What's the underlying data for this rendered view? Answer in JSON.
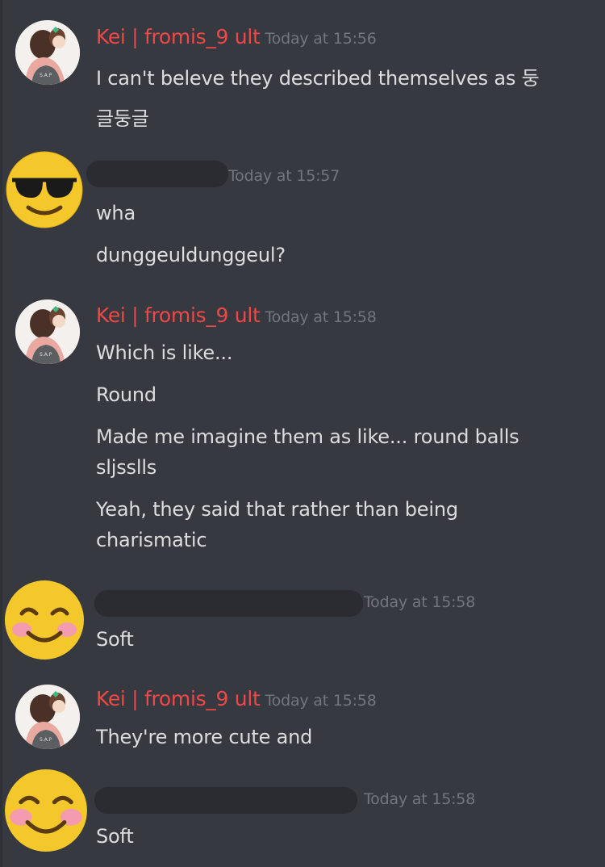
{
  "messages": [
    {
      "author": "Kei | fromis_9 ult",
      "timestamp": "Today at 15:56",
      "lines": [
        "I can't beleve they described themselves as 둥글둥글"
      ]
    },
    {
      "author_avatar_icon": "sunglasses-emoji-icon",
      "timestamp": "Today at 15:57",
      "lines": [
        "wha",
        "dunggeuldunggeul?"
      ]
    },
    {
      "author": "Kei | fromis_9 ult",
      "timestamp": "Today at 15:58",
      "lines": [
        "Which is like...",
        "Round",
        "Made me imagine them as like... round balls sljsslls",
        "Yeah, they said that rather than being charismatic"
      ]
    },
    {
      "author_avatar_icon": "smiling-blush-emoji-icon",
      "timestamp": "Today at 15:58",
      "lines": [
        "Soft"
      ]
    },
    {
      "author": "Kei | fromis_9 ult",
      "timestamp": "Today at 15:58",
      "lines": [
        "They're more cute and"
      ]
    },
    {
      "author_avatar_icon": "smiling-blush-emoji-icon",
      "timestamp": "Today at 15:58",
      "lines": [
        "Soft"
      ]
    }
  ],
  "colors": {
    "background": "#36393f",
    "author_name": "#f04747",
    "message_text": "#dcddde",
    "timestamp": "#72767d",
    "redaction": "#2a2c31"
  }
}
